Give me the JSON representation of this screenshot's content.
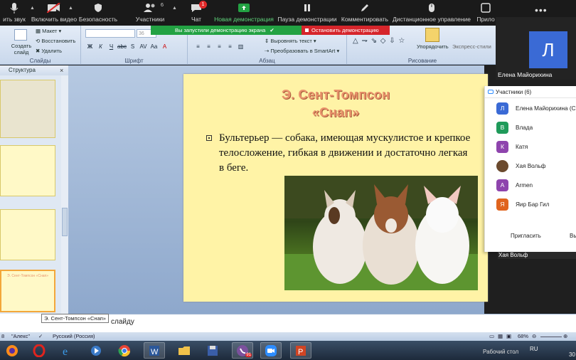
{
  "zoom_toolbar": {
    "audio_label": "ить звук",
    "video_label": "Включить видео",
    "security_label": "Безопасность",
    "participants_label": "Участники",
    "participants_count": "6",
    "chat_label": "Чат",
    "chat_badge": "1",
    "new_share_label": "Новая демонстрация",
    "pause_share_label": "Пауза демонстрации",
    "annotate_label": "Комментировать",
    "remote_control_label": "Дистанционное управление",
    "more_label": "Прило"
  },
  "share_banner": {
    "status": "Вы запустили демонстрацию экрана",
    "stop_label": "Остановить демонстрацию"
  },
  "ribbon": {
    "create_slide": "Создать слайд",
    "layout": "Макет",
    "restore": "Восстановить",
    "delete": "Удалить",
    "group_slides": "Слайды",
    "group_font": "Шрифт",
    "font_size": "36",
    "align_text": "Выровнять текст",
    "smartart": "Преобразовать в SmartArt",
    "group_paragraph": "Абзац",
    "arrange": "Упорядочить",
    "express_styles": "Экспресс-стили",
    "group_drawing": "Рисование"
  },
  "video": {
    "avatar_letter": "Л",
    "name": "Елена Майорихина",
    "secondary_name": "Хая Вольф"
  },
  "participants_panel": {
    "title": "Участники (6)",
    "items": [
      {
        "initial": "Л",
        "name": "Елена Майорихина (С",
        "color": "#3a6ad5"
      },
      {
        "initial": "В",
        "name": "Влада",
        "color": "#1f9a5a"
      },
      {
        "initial": "К",
        "name": "Катя",
        "color": "#8e44ad"
      },
      {
        "initial": "",
        "name": "Хая Вольф",
        "color": "#6b4a2e"
      },
      {
        "initial": "A",
        "name": "Armen",
        "color": "#8e44ad"
      },
      {
        "initial": "Я",
        "name": "Яир Бар Гил",
        "color": "#e0641e"
      }
    ],
    "invite_label": "Пригласить",
    "more_label": "Вы"
  },
  "left_panel": {
    "tab_label": "Структура",
    "selected_thumb_title": "Э. Сент-Томпсон «Снап»"
  },
  "slide": {
    "title_line1": "Э. Сент-Томпсон",
    "title_line2": "«Снап»",
    "body": "Бультерьер — собака, имеющая мускулистое и крепкое телосложение, гибкая в движении и достаточно легкая в беге."
  },
  "notes": {
    "tooltip": "Э. Сент-Томпсон «Снап»",
    "text": "слайду"
  },
  "status_bar": {
    "slide_num": "8",
    "theme": "\"Алекс\"",
    "language": "Русский (Россия)",
    "zoom": "68%"
  },
  "taskbar": {
    "desktop": "Рабочий стол",
    "lang": "RU",
    "clock": "30",
    "viber_badge": "91"
  }
}
